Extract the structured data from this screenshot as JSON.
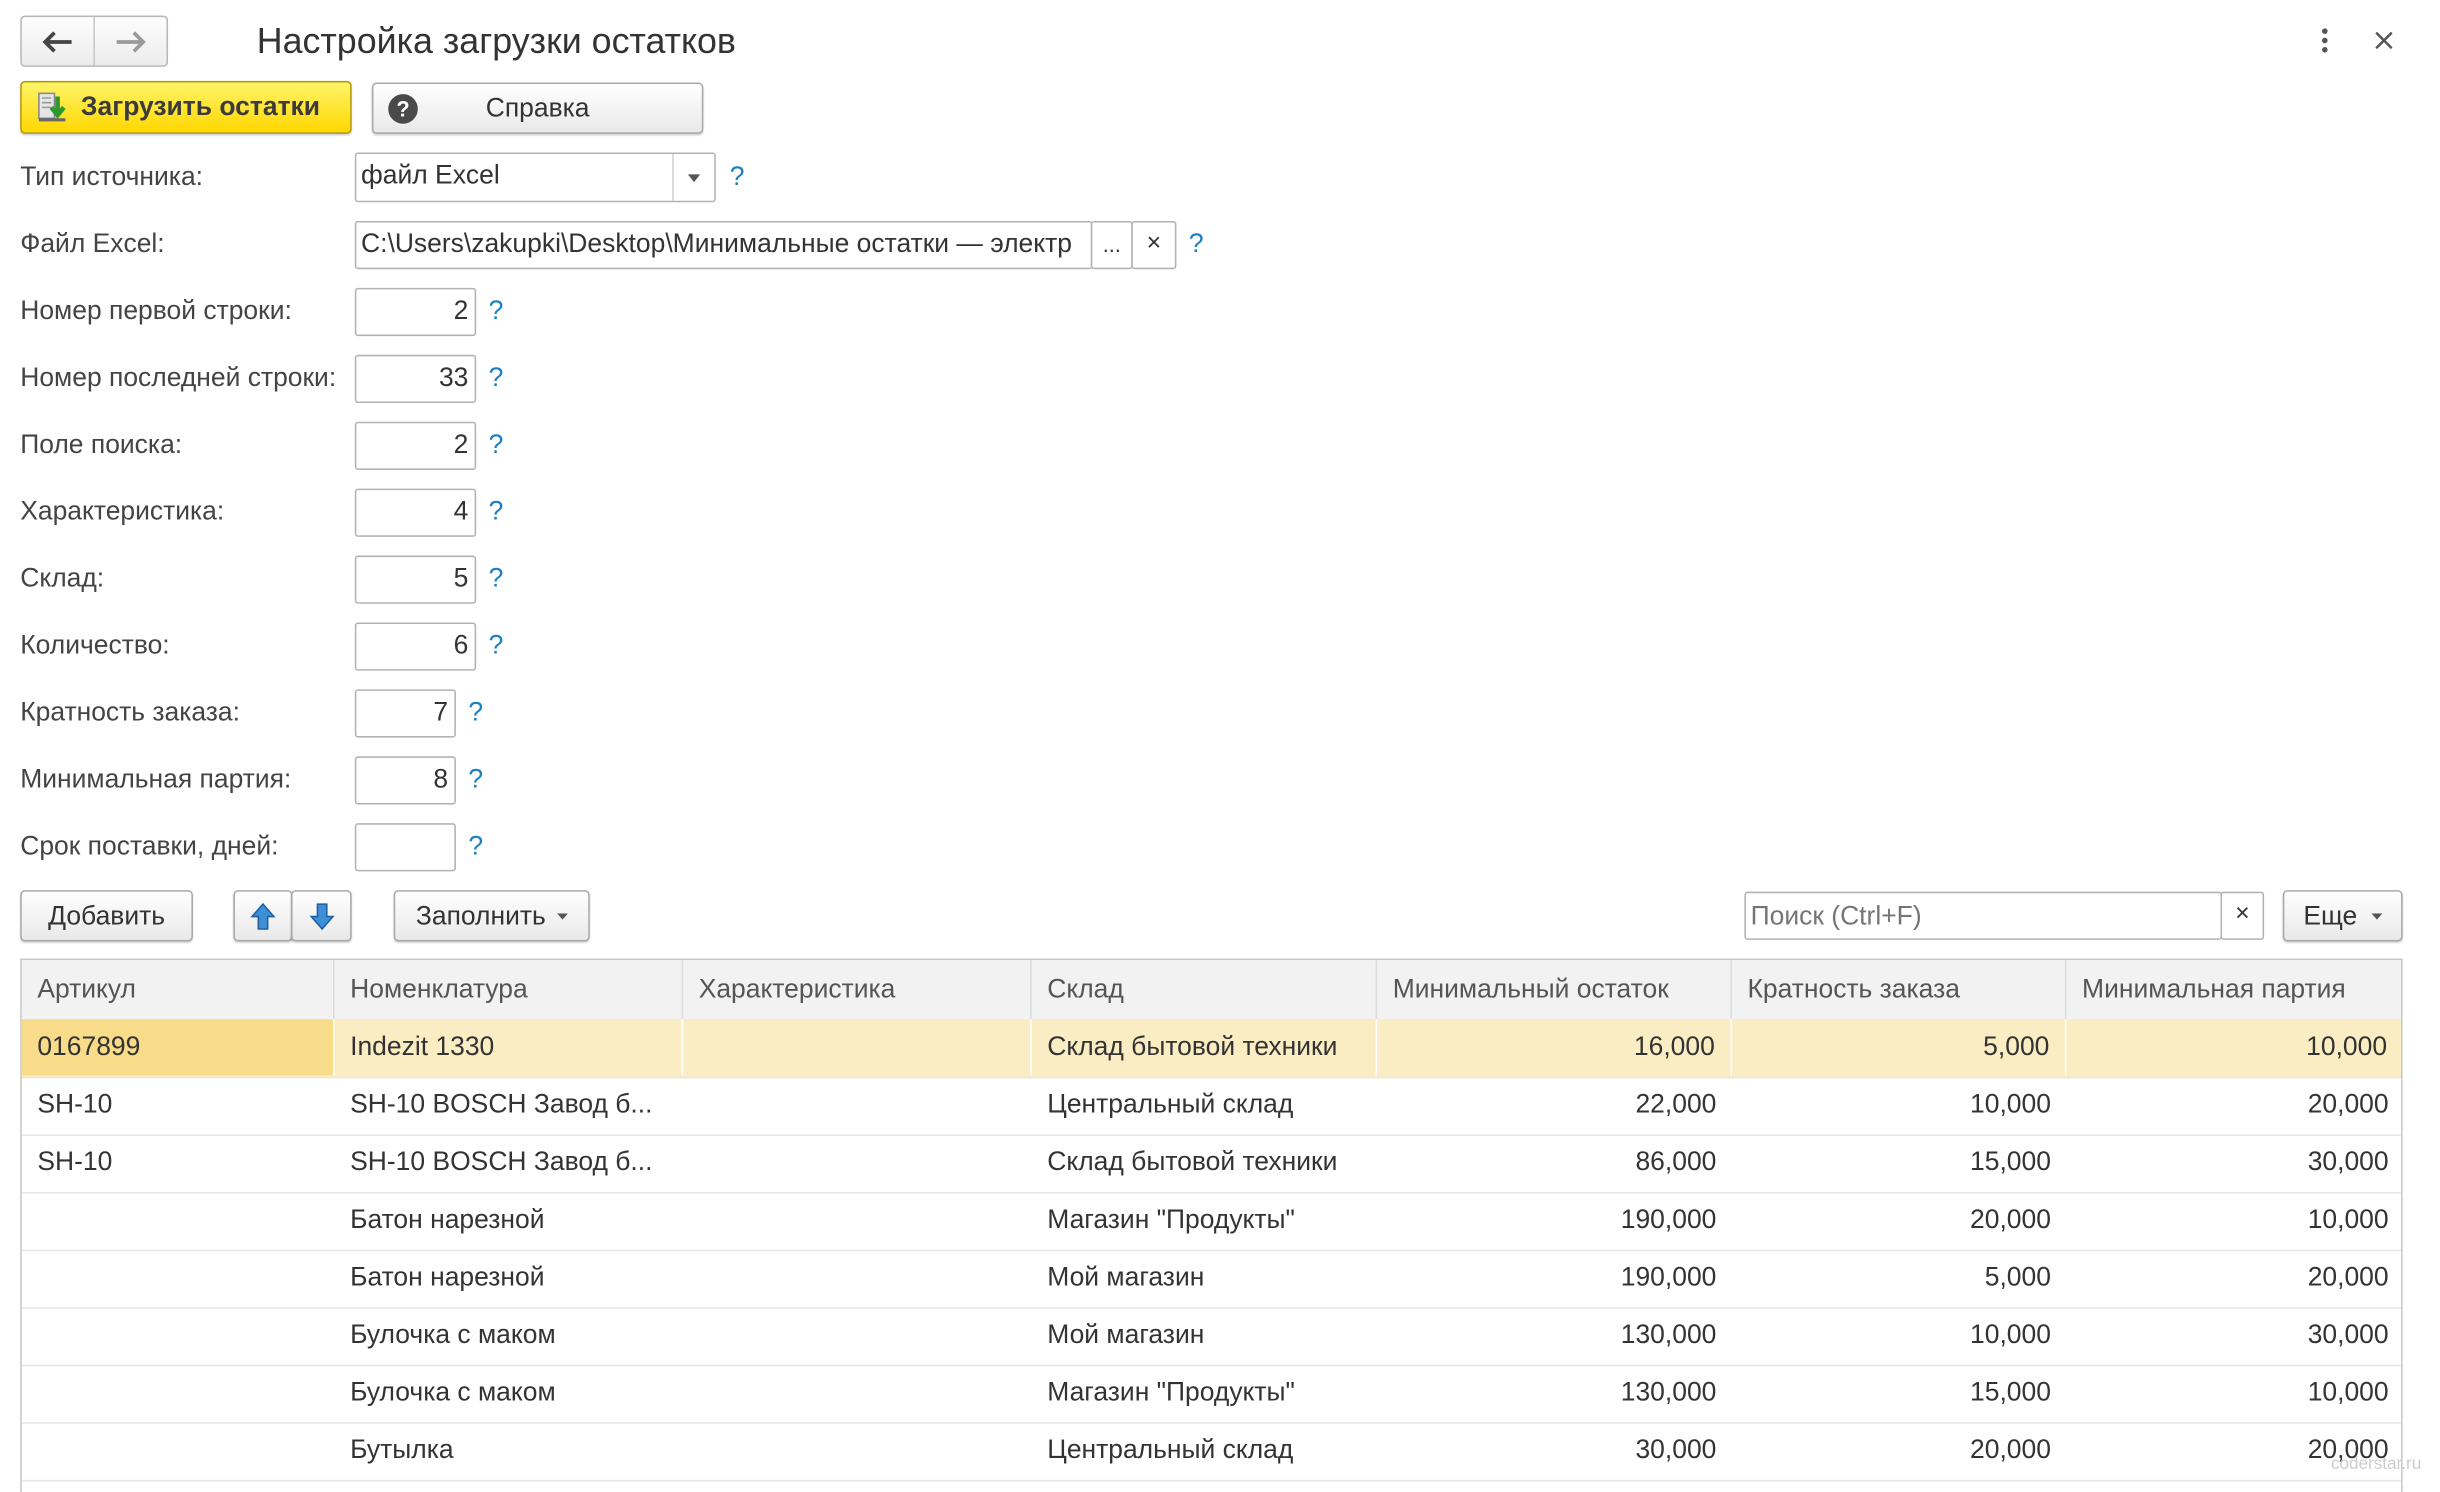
{
  "window": {
    "title": "Настройка загрузки остатков",
    "nav_back_icon": "arrow-left-icon",
    "nav_forward_icon": "arrow-right-icon",
    "more_icon": "kebab-menu-icon",
    "close_icon": "close-icon"
  },
  "toolbar": {
    "load_label": "Загрузить остатки",
    "load_icon": "download-arrow-icon",
    "help_label": "Справка",
    "help_icon": "question-circle-icon"
  },
  "form": {
    "source_type": {
      "label": "Тип источника:",
      "value": "файл Excel"
    },
    "excel_file": {
      "label": "Файл Excel:",
      "value": "C:\\Users\\zakupki\\Desktop\\Минимальные остатки — электр",
      "browse_label": "...",
      "clear_label": "×"
    },
    "first_row": {
      "label": "Номер первой строки:",
      "value": "2"
    },
    "last_row": {
      "label": "Номер последней строки:",
      "value": "33"
    },
    "search_field": {
      "label": "Поле поиска:",
      "value": "2"
    },
    "characteristic": {
      "label": "Характеристика:",
      "value": "4"
    },
    "warehouse": {
      "label": "Склад:",
      "value": "5"
    },
    "quantity": {
      "label": "Количество:",
      "value": "6"
    },
    "order_multiplicity": {
      "label": "Кратность заказа:",
      "value": "7"
    },
    "min_batch": {
      "label": "Минимальная партия:",
      "value": "8"
    },
    "delivery_days": {
      "label": "Срок поставки, дней:",
      "value": ""
    },
    "help_mark": "?"
  },
  "table_toolbar": {
    "add_label": "Добавить",
    "up_icon": "arrow-up-icon",
    "down_icon": "arrow-down-icon",
    "fill_label": "Заполнить",
    "search_placeholder": "Поиск (Ctrl+F)",
    "search_clear": "×",
    "more_label": "Еще"
  },
  "table": {
    "columns": [
      "Артикул",
      "Номенклатура",
      "Характеристика",
      "Склад",
      "Минимальный остаток",
      "Кратность заказа",
      "Минимальная партия"
    ],
    "rows": [
      {
        "article": "0167899",
        "item": "Indezit 1330",
        "characteristic": "",
        "warehouse": "Склад бытовой техники",
        "min_stock": "16,000",
        "multiplicity": "5,000",
        "min_batch": "10,000",
        "selected": true
      },
      {
        "article": "SH-10",
        "item": "SH-10 BOSCH Завод б...",
        "characteristic": "",
        "warehouse": "Центральный склад",
        "min_stock": "22,000",
        "multiplicity": "10,000",
        "min_batch": "20,000"
      },
      {
        "article": "SH-10",
        "item": "SH-10 BOSCH Завод б...",
        "characteristic": "",
        "warehouse": "Склад бытовой техники",
        "min_stock": "86,000",
        "multiplicity": "15,000",
        "min_batch": "30,000"
      },
      {
        "article": "",
        "item": "Батон нарезной",
        "characteristic": "",
        "warehouse": "Магазин \"Продукты\"",
        "min_stock": "190,000",
        "multiplicity": "20,000",
        "min_batch": "10,000"
      },
      {
        "article": "",
        "item": "Батон нарезной",
        "characteristic": "",
        "warehouse": "Мой магазин",
        "min_stock": "190,000",
        "multiplicity": "5,000",
        "min_batch": "20,000"
      },
      {
        "article": "",
        "item": "Булочка с маком",
        "characteristic": "",
        "warehouse": "Мой магазин",
        "min_stock": "130,000",
        "multiplicity": "10,000",
        "min_batch": "30,000"
      },
      {
        "article": "",
        "item": "Булочка с маком",
        "characteristic": "",
        "warehouse": "Магазин \"Продукты\"",
        "min_stock": "130,000",
        "multiplicity": "15,000",
        "min_batch": "10,000"
      },
      {
        "article": "",
        "item": "Бутылка",
        "characteristic": "",
        "warehouse": "Центральный склад",
        "min_stock": "30,000",
        "multiplicity": "20,000",
        "min_batch": "20,000"
      }
    ]
  },
  "watermark": "coderstar.ru",
  "colors": {
    "primary_button": "#ffd700",
    "selected_row": "#fbedc3",
    "selected_cell": "#f9dc8a",
    "help_mark": "#1a7fc4"
  }
}
